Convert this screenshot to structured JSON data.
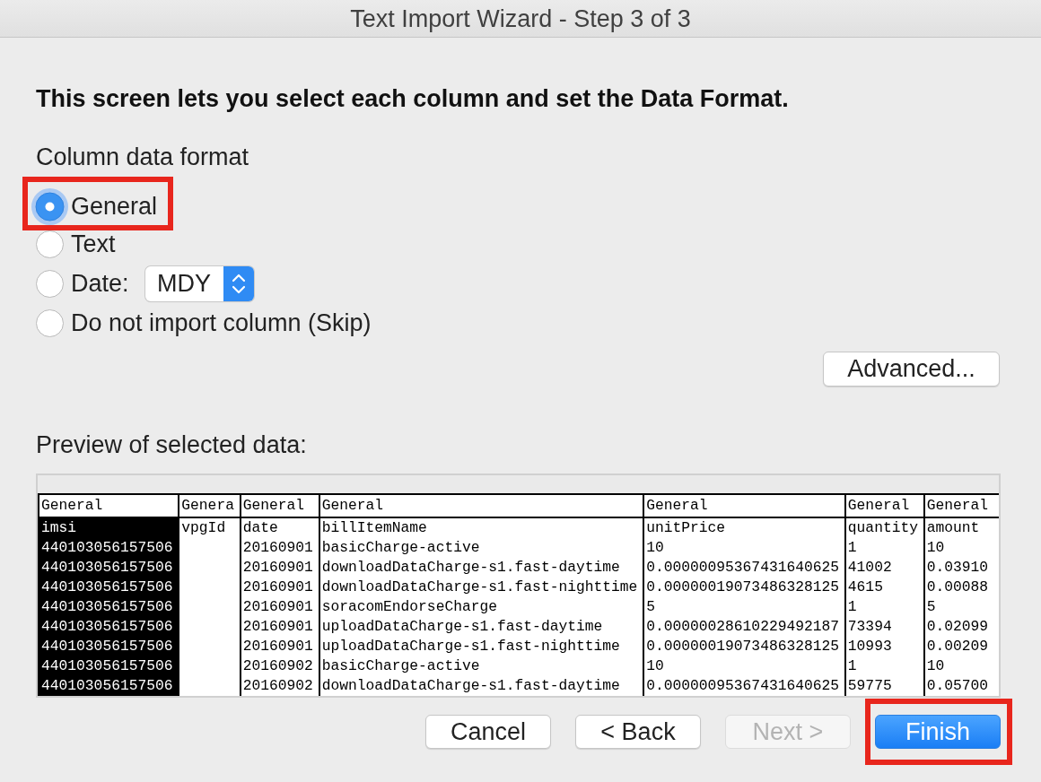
{
  "window": {
    "title": "Text Import Wizard - Step 3 of 3"
  },
  "instruction": "This screen lets you select each column and set the Data Format.",
  "column_data_format": {
    "label": "Column data format",
    "options": [
      {
        "kind": "plain",
        "label": "General",
        "selected": true,
        "highlighted": true
      },
      {
        "kind": "plain",
        "label": "Text",
        "selected": false,
        "highlighted": false
      },
      {
        "kind": "date",
        "label": "Date:",
        "selected": false,
        "highlighted": false,
        "date_order": "MDY"
      },
      {
        "kind": "plain",
        "label": "Do not import column (Skip)",
        "selected": false,
        "highlighted": false
      }
    ]
  },
  "advanced_button": "Advanced...",
  "preview": {
    "label": "Preview of selected data:",
    "columns": [
      {
        "format": "General",
        "selected": true,
        "cells": [
          "imsi",
          "440103056157506",
          "440103056157506",
          "440103056157506",
          "440103056157506",
          "440103056157506",
          "440103056157506",
          "440103056157506",
          "440103056157506"
        ]
      },
      {
        "format": "Genera",
        "selected": false,
        "cells": [
          "vpgId"
        ]
      },
      {
        "format": "General",
        "selected": false,
        "cells": [
          "date",
          "20160901",
          "20160901",
          "20160901",
          "20160901",
          "20160901",
          "20160901",
          "20160902",
          "20160902"
        ]
      },
      {
        "format": "General",
        "selected": false,
        "cells": [
          "billItemName",
          "basicCharge-active",
          "downloadDataCharge-s1.fast-daytime",
          "downloadDataCharge-s1.fast-nighttime",
          "soracomEndorseCharge",
          "uploadDataCharge-s1.fast-daytime",
          "uploadDataCharge-s1.fast-nighttime",
          "basicCharge-active",
          "downloadDataCharge-s1.fast-daytime"
        ]
      },
      {
        "format": "General",
        "selected": false,
        "cells": [
          "unitPrice",
          "10",
          "0.00000095367431640625",
          "0.00000019073486328125",
          "5",
          "0.00000028610229492187",
          "0.00000019073486328125",
          "10",
          "0.00000095367431640625"
        ]
      },
      {
        "format": "General",
        "selected": false,
        "cells": [
          "quantity",
          "1",
          "41002",
          "4615",
          "1",
          "73394",
          "10993",
          "1",
          "59775"
        ]
      },
      {
        "format": "General",
        "selected": false,
        "cells": [
          "amount",
          "10",
          "0.03910",
          "0.00088",
          "5",
          "0.02099",
          "0.00209",
          "10",
          "0.05700"
        ]
      }
    ]
  },
  "buttons": [
    {
      "label": "Cancel",
      "disabled": false,
      "default": false,
      "highlighted": false
    },
    {
      "label": "< Back",
      "disabled": false,
      "default": false,
      "highlighted": false
    },
    {
      "label": "Next >",
      "disabled": true,
      "default": false,
      "highlighted": false
    },
    {
      "label": "Finish",
      "disabled": false,
      "default": true,
      "highlighted": true
    }
  ]
}
